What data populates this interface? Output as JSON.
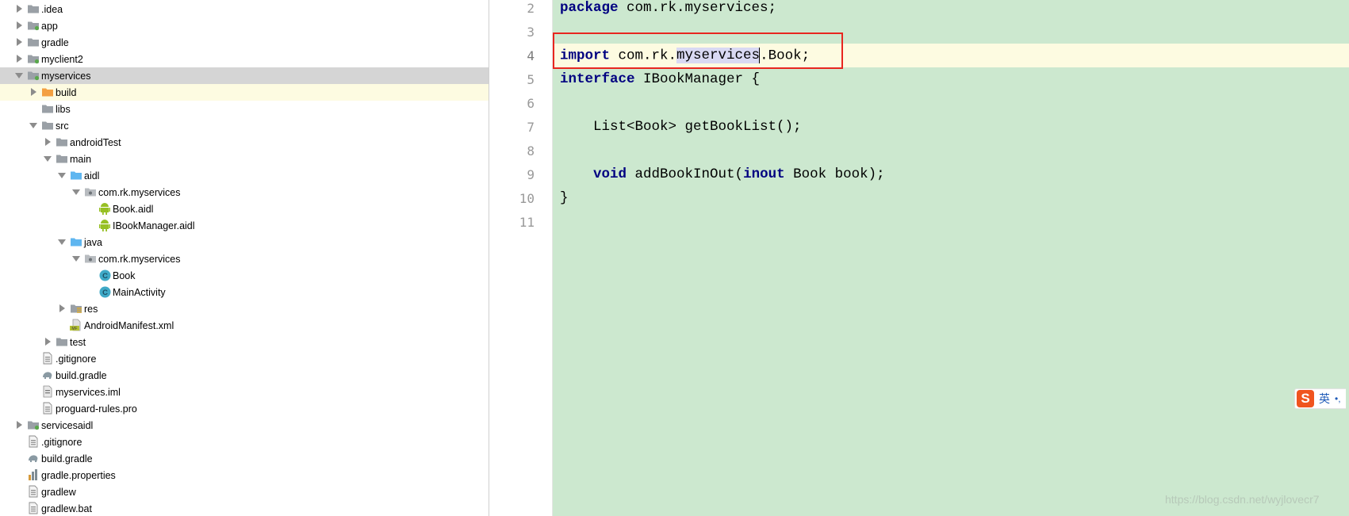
{
  "colors": {
    "editor_bg": "#cce8cf",
    "current_line_bg": "#fdfbe1",
    "selected_row_bg": "#d5d5d5",
    "keyword": "#000080",
    "red_box": "#e8261f",
    "folder_gray": "#9aa0a6",
    "folder_orange": "#f4a041",
    "folder_blue": "#5fb6f0",
    "class_icon": "#3fa9c7",
    "android_green": "#97c024"
  },
  "tree": [
    {
      "label": ".idea",
      "icon": "folder-icon",
      "expanded": false
    },
    {
      "label": "app",
      "icon": "module-folder-icon",
      "expanded": false
    },
    {
      "label": "gradle",
      "icon": "folder-icon",
      "expanded": false
    },
    {
      "label": "myclient2",
      "icon": "module-folder-icon",
      "expanded": false
    },
    {
      "label": "myservices",
      "icon": "module-folder-icon",
      "expanded": true
    },
    {
      "label": "build",
      "icon": "build-folder-icon",
      "expanded": false
    },
    {
      "label": "libs",
      "icon": "folder-icon"
    },
    {
      "label": "src",
      "icon": "folder-icon",
      "expanded": true
    },
    {
      "label": "androidTest",
      "icon": "folder-icon",
      "expanded": false
    },
    {
      "label": "main",
      "icon": "folder-icon",
      "expanded": true
    },
    {
      "label": "aidl",
      "icon": "source-folder-icon",
      "expanded": true
    },
    {
      "label": "com.rk.myservices",
      "icon": "package-icon",
      "expanded": true
    },
    {
      "label": "Book.aidl",
      "icon": "android-file-icon"
    },
    {
      "label": "IBookManager.aidl",
      "icon": "android-file-icon"
    },
    {
      "label": "java",
      "icon": "source-folder-icon",
      "expanded": true
    },
    {
      "label": "com.rk.myservices",
      "icon": "package-icon",
      "expanded": true
    },
    {
      "label": "Book",
      "icon": "class-icon"
    },
    {
      "label": "MainActivity",
      "icon": "class-icon"
    },
    {
      "label": "res",
      "icon": "resource-folder-icon",
      "expanded": false
    },
    {
      "label": "AndroidManifest.xml",
      "icon": "manifest-file-icon"
    },
    {
      "label": "test",
      "icon": "folder-icon",
      "expanded": false
    },
    {
      "label": ".gitignore",
      "icon": "text-file-icon"
    },
    {
      "label": "build.gradle",
      "icon": "gradle-file-icon"
    },
    {
      "label": "myservices.iml",
      "icon": "iml-file-icon"
    },
    {
      "label": "proguard-rules.pro",
      "icon": "text-file-icon"
    },
    {
      "label": "servicesaidl",
      "icon": "module-folder-icon",
      "expanded": false
    },
    {
      "label": ".gitignore",
      "icon": "text-file-icon"
    },
    {
      "label": "build.gradle",
      "icon": "gradle-file-icon"
    },
    {
      "label": "gradle.properties",
      "icon": "properties-file-icon"
    },
    {
      "label": "gradlew",
      "icon": "text-file-icon"
    },
    {
      "label": "gradlew.bat",
      "icon": "text-file-icon"
    }
  ],
  "editor": {
    "lines": [
      {
        "n": "2",
        "text": "package com.rk.myservices;"
      },
      {
        "n": "3",
        "text": ""
      },
      {
        "n": "4",
        "text": "import com.rk.myservices.Book;"
      },
      {
        "n": "5",
        "text": "interface IBookManager {"
      },
      {
        "n": "6",
        "text": ""
      },
      {
        "n": "7",
        "text": "    List<Book> getBookList();"
      },
      {
        "n": "8",
        "text": ""
      },
      {
        "n": "9",
        "text": "    void addBookInOut(inout Book book);"
      },
      {
        "n": "10",
        "text": "}"
      },
      {
        "n": "11",
        "text": ""
      }
    ],
    "current_line": "4",
    "highlighted_word": "myservices"
  },
  "ime": {
    "icon": "sogou-ime-icon",
    "logo": "S",
    "mode": "英",
    "punct": "•,"
  },
  "watermark": "https://blog.csdn.net/wyjlovecr7"
}
